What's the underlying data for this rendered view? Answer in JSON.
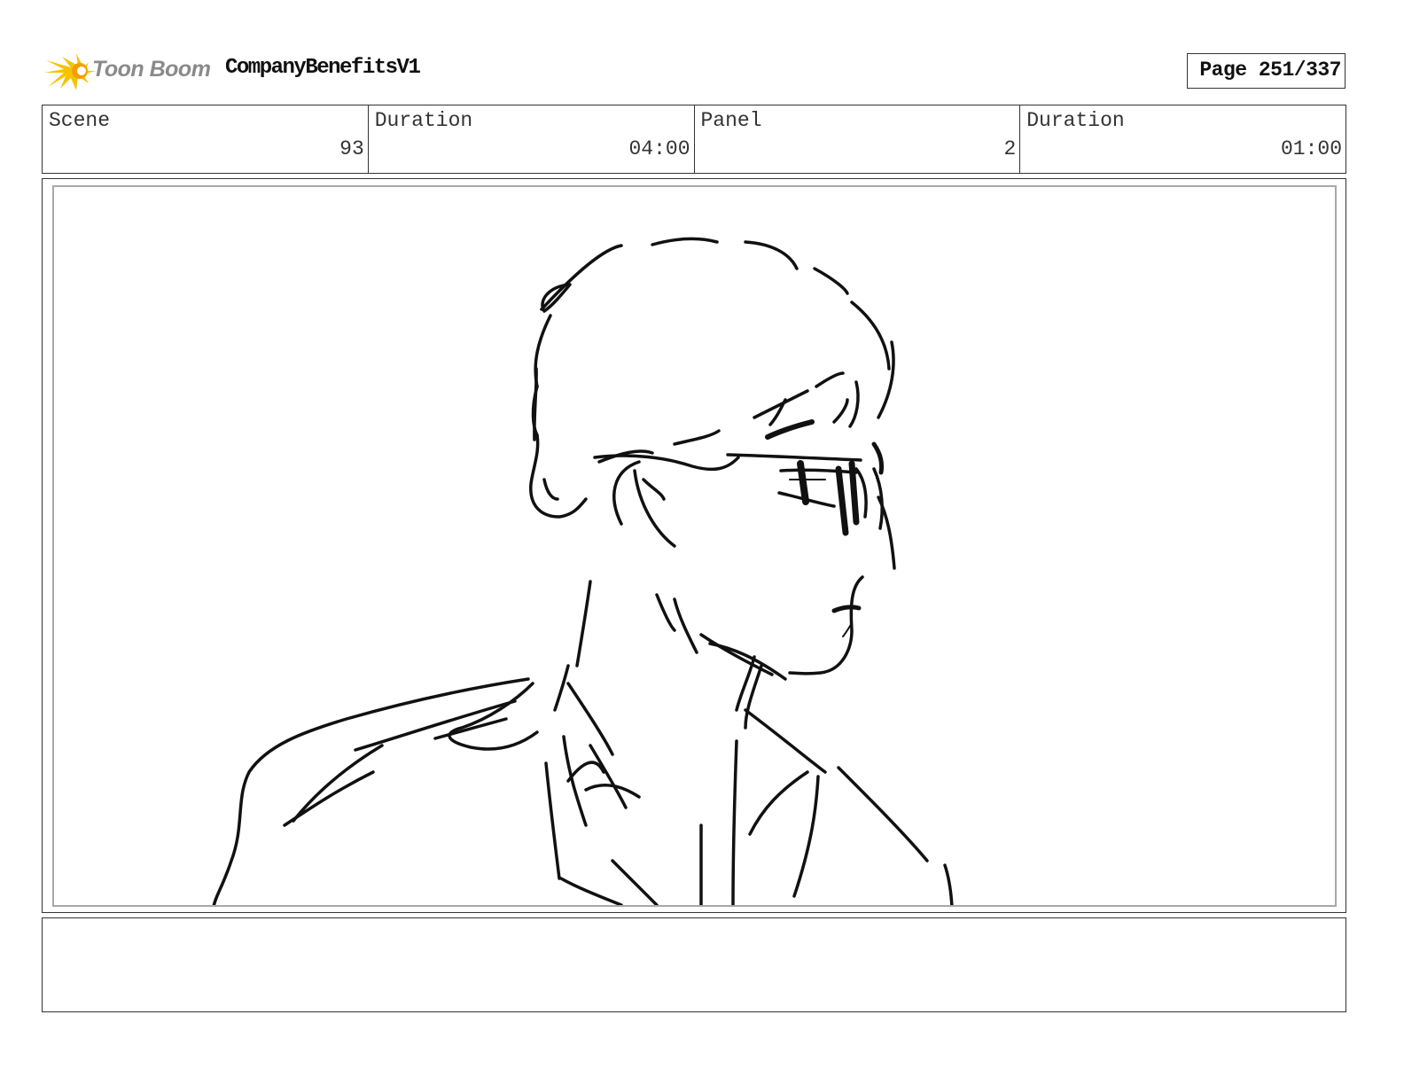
{
  "header": {
    "logo_text": "Toon Boom",
    "project_title": "CompanyBenefitsV1",
    "page_indicator": "Page 251/337"
  },
  "info": {
    "scene_label": "Scene",
    "scene_value": "93",
    "scene_duration_label": "Duration",
    "scene_duration_value": "04:00",
    "panel_label": "Panel",
    "panel_value": "2",
    "panel_duration_label": "Duration",
    "panel_duration_value": "01:00"
  },
  "panel": {
    "sketch_subject": "man-with-glasses-sketch"
  },
  "notes": {
    "text": ""
  },
  "colors": {
    "logo_yellow": "#f5c400",
    "logo_orange": "#f0a000",
    "frame_inner_border": "#a8a8a8"
  }
}
